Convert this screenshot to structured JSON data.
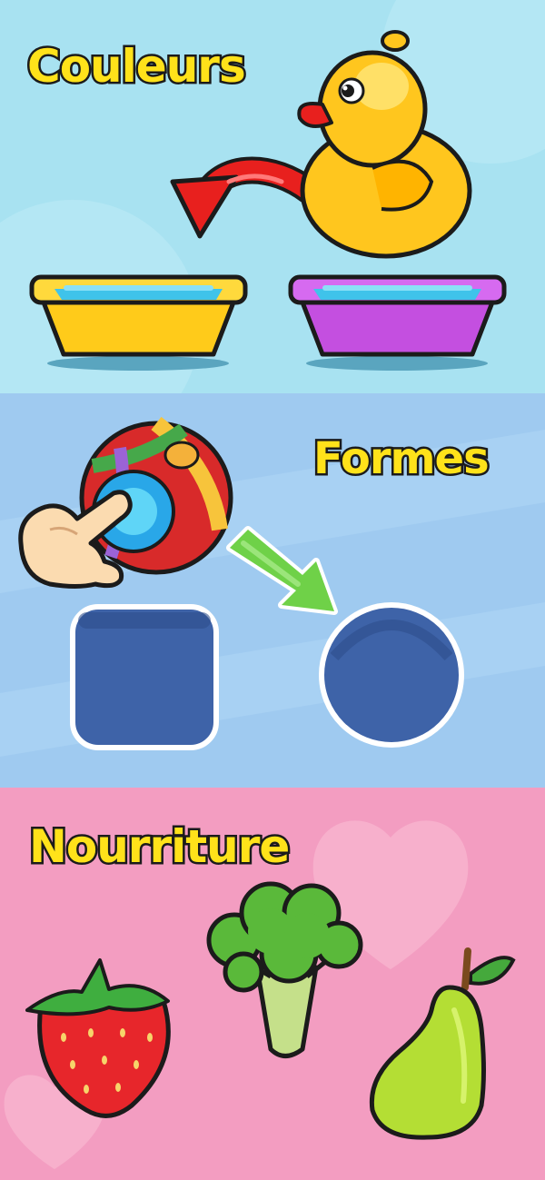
{
  "panels": [
    {
      "title": "Couleurs",
      "bg": "#a8e2f1",
      "title_color": "#ffe21a"
    },
    {
      "title": "Formes",
      "bg": "#9fcaf0",
      "title_color": "#ffe21a"
    },
    {
      "title": "Nourriture",
      "bg": "#f39dc1",
      "title_color": "#ffe21a"
    }
  ],
  "icons": {
    "colors": [
      "rubber-duck",
      "red-curved-arrow",
      "yellow-basin",
      "purple-basin"
    ],
    "shapes": [
      "beach-ball",
      "pointing-hand",
      "green-arrow",
      "square-slot",
      "circle-slot"
    ],
    "food": [
      "strawberry",
      "broccoli",
      "pear",
      "heart"
    ]
  }
}
